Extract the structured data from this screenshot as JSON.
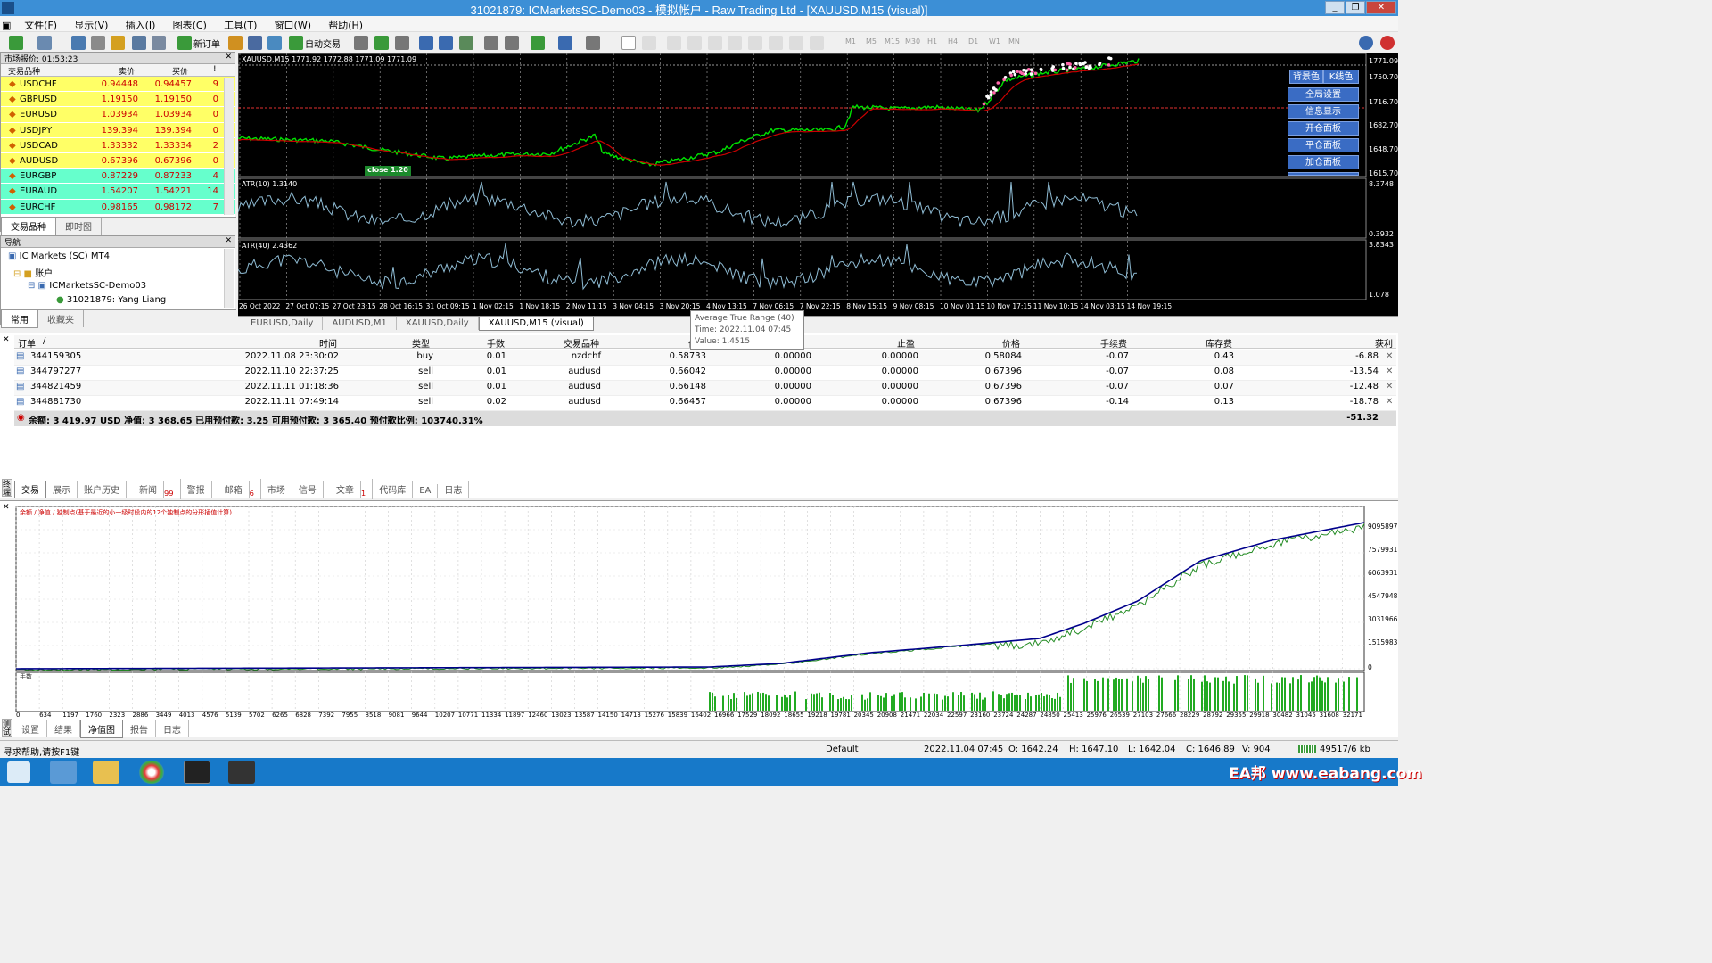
{
  "window": {
    "title": "31021879: ICMarketsSC-Demo03 - 模拟帐户 - Raw Trading Ltd - [XAUUSD,M15 (visual)]"
  },
  "menu": [
    "文件(F)",
    "显示(V)",
    "插入(I)",
    "图表(C)",
    "工具(T)",
    "窗口(W)",
    "帮助(H)"
  ],
  "toolbar": {
    "new_order": "新订单",
    "auto_trade": "自动交易",
    "timeframes": [
      "M1",
      "M5",
      "M15",
      "M30",
      "H1",
      "H4",
      "D1",
      "W1",
      "MN"
    ]
  },
  "market_watch": {
    "title": "市场报价: 01:53:23",
    "col_symbol": "交易品种",
    "col_bid": "卖价",
    "col_ask": "买价",
    "col_spread": "!",
    "rows": [
      {
        "symbol": "USDCHF",
        "bid": "0.94448",
        "ask": "0.94457",
        "spread": "9"
      },
      {
        "symbol": "GBPUSD",
        "bid": "1.19150",
        "ask": "1.19150",
        "spread": "0"
      },
      {
        "symbol": "EURUSD",
        "bid": "1.03934",
        "ask": "1.03934",
        "spread": "0"
      },
      {
        "symbol": "USDJPY",
        "bid": "139.394",
        "ask": "139.394",
        "spread": "0"
      },
      {
        "symbol": "USDCAD",
        "bid": "1.33332",
        "ask": "1.33334",
        "spread": "2"
      },
      {
        "symbol": "AUDUSD",
        "bid": "0.67396",
        "ask": "0.67396",
        "spread": "0"
      },
      {
        "symbol": "EURGBP",
        "bid": "0.87229",
        "ask": "0.87233",
        "spread": "4"
      },
      {
        "symbol": "EURAUD",
        "bid": "1.54207",
        "ask": "1.54221",
        "spread": "14"
      },
      {
        "symbol": "EURCHF",
        "bid": "0.98165",
        "ask": "0.98172",
        "spread": "7"
      }
    ],
    "tabs": [
      "交易品种",
      "即时图"
    ]
  },
  "navigator": {
    "title": "导航",
    "items": [
      "IC Markets (SC) MT4",
      "账户",
      "ICMarketsSC-Demo03",
      "31021879: Yang Liang"
    ],
    "tabs": [
      "常用",
      "收藏夹"
    ]
  },
  "chart": {
    "main_label": "XAUUSD,M15  1771.92 1772.88 1771.09 1771.09",
    "atr10_label": "ATR(10) 1.3140",
    "atr40_label": "ATR(40) 2.4362",
    "close_label": "close 1.20",
    "price_axis": [
      "1771.09",
      "1750.70",
      "1716.70",
      "1682.70",
      "1648.70",
      "1615.70"
    ],
    "atr10_axis": [
      "8.3748",
      "0.3932"
    ],
    "atr40_axis": [
      "3.8343",
      "1.078"
    ],
    "time_axis": [
      "26 Oct 2022",
      "27 Oct 07:15",
      "27 Oct 23:15",
      "28 Oct 16:15",
      "31 Oct 09:15",
      "1 Nov 02:15",
      "1 Nov 18:15",
      "2 Nov 11:15",
      "3 Nov 04:15",
      "3 Nov 20:15",
      "4 Nov 13:15",
      "7 Nov 06:15",
      "7 Nov 22:15",
      "8 Nov 15:15",
      "9 Nov 08:15",
      "10 Nov 01:15",
      "10 Nov 17:15",
      "11 Nov 10:15",
      "14 Nov 03:15",
      "14 Nov 19:15"
    ],
    "panel_buttons": [
      "背景色",
      "K线色",
      "全局设置",
      "信息显示",
      "开仓面板",
      "平仓面板",
      "加仓面板"
    ],
    "tabs": [
      "EURUSD,Daily",
      "AUDUSD,M1",
      "XAUUSD,Daily",
      "XAUUSD,M15 (visual)"
    ]
  },
  "tooltip": {
    "line1": "Average True Range (40)",
    "line2": "Time: 2022.11.04 07:45",
    "line3": "Value: 1.4515"
  },
  "terminal": {
    "columns": [
      "订单",
      "/",
      "时间",
      "类型",
      "手数",
      "交易品种",
      "价位",
      "止损",
      "止盈",
      "价格",
      "手续费",
      "库存费",
      "获利"
    ],
    "orders": [
      {
        "id": "344159305",
        "time": "2022.11.08 23:30:02",
        "type": "buy",
        "lots": "0.01",
        "symbol": "nzdchf",
        "open": "0.58733",
        "sl": "0.00000",
        "tp": "0.00000",
        "price": "0.58084",
        "commission": "-0.07",
        "swap": "0.43",
        "profit": "-6.88"
      },
      {
        "id": "344797277",
        "time": "2022.11.10 22:37:25",
        "type": "sell",
        "lots": "0.01",
        "symbol": "audusd",
        "open": "0.66042",
        "sl": "0.00000",
        "tp": "0.00000",
        "price": "0.67396",
        "commission": "-0.07",
        "swap": "0.08",
        "profit": "-13.54"
      },
      {
        "id": "344821459",
        "time": "2022.11.11 01:18:36",
        "type": "sell",
        "lots": "0.01",
        "symbol": "audusd",
        "open": "0.66148",
        "sl": "0.00000",
        "tp": "0.00000",
        "price": "0.67396",
        "commission": "-0.07",
        "swap": "0.07",
        "profit": "-12.48"
      },
      {
        "id": "344881730",
        "time": "2022.11.11 07:49:14",
        "type": "sell",
        "lots": "0.02",
        "symbol": "audusd",
        "open": "0.66457",
        "sl": "0.00000",
        "tp": "0.00000",
        "price": "0.67396",
        "commission": "-0.14",
        "swap": "0.13",
        "profit": "-18.78"
      }
    ],
    "balance_line": "余额: 3 419.97 USD  净值: 3 368.65  已用预付款: 3.25  可用预付款: 3 365.40  预付款比例: 103740.31%",
    "total_profit": "-51.32",
    "tabs": [
      "交易",
      "展示",
      "账户历史",
      "新闻",
      "警报",
      "邮箱",
      "市场",
      "信号",
      "文章",
      "代码库",
      "EA",
      "日志"
    ],
    "badges": {
      "news": "99",
      "mail": "6",
      "articles": "1"
    },
    "side_label": "终端"
  },
  "tester": {
    "legend": "余额 / 净值 / 独制点(基于最近的小一级时段内的12个独制点的分形插值计算)",
    "lot_label": "手数",
    "y_axis": [
      "9095897",
      "7579931",
      "6063931",
      "4547948",
      "3031966",
      "1515983",
      "0"
    ],
    "x_axis": [
      "0",
      "634",
      "1197",
      "1760",
      "2323",
      "2886",
      "3449",
      "4013",
      "4576",
      "5139",
      "5702",
      "6265",
      "6828",
      "7392",
      "7955",
      "8518",
      "9081",
      "9644",
      "10207",
      "10771",
      "11334",
      "11897",
      "12460",
      "13023",
      "13587",
      "14150",
      "14713",
      "15276",
      "15839",
      "16402",
      "16966",
      "17529",
      "18092",
      "18655",
      "19218",
      "19781",
      "20345",
      "20908",
      "21471",
      "22034",
      "22597",
      "23160",
      "23724",
      "24287",
      "24850",
      "25413",
      "25976",
      "26539",
      "27103",
      "27666",
      "28229",
      "28792",
      "29355",
      "29918",
      "30482",
      "31045",
      "31608",
      "32171"
    ],
    "tabs": [
      "设置",
      "结果",
      "净值图",
      "报告",
      "日志"
    ],
    "side_label": "测试",
    "balance_color": "#00008b",
    "equity_color": "#228b22"
  },
  "status": {
    "help": "寻求帮助,请按F1键",
    "profile": "Default",
    "time": "2022.11.04 07:45",
    "open": "O: 1642.24",
    "high": "H: 1647.10",
    "low": "L: 1642.04",
    "close": "C: 1646.89",
    "volume": "V: 904",
    "traffic": "49517/6 kb"
  },
  "taskbar": {
    "watermark": "EA邦 www.eabang.com"
  },
  "colors": {
    "titlebar": "#3c8fd6",
    "mw_yellow": "#ffff66",
    "mw_green": "#66ffcc",
    "price_up": "#00e000",
    "ma_red": "#cc0000",
    "atr": "#8fbcd4"
  }
}
